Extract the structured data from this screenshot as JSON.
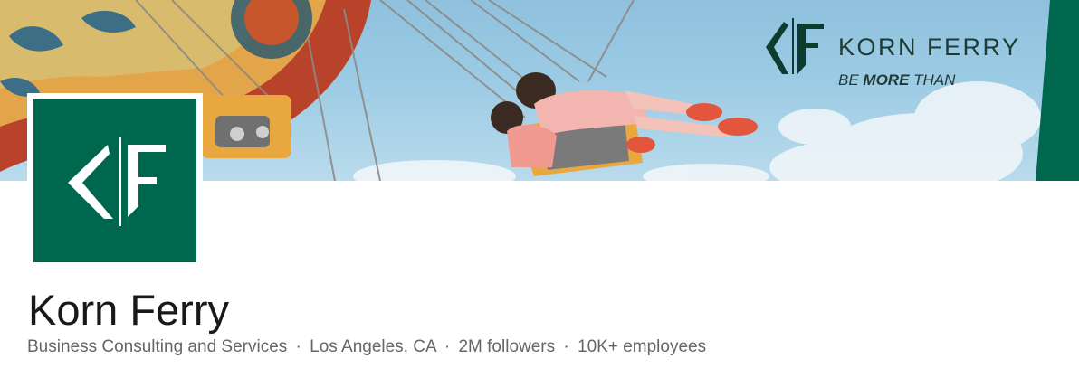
{
  "banner": {
    "brand_name": "KORN FERRY",
    "tagline_prefix": "BE ",
    "tagline_bold": "MORE",
    "tagline_suffix": " THAN"
  },
  "company": {
    "name": "Korn Ferry",
    "industry": "Business Consulting and Services",
    "location": "Los Angeles, CA",
    "followers": "2M followers",
    "employees": "10K+ employees",
    "separator": "·"
  },
  "colors": {
    "brand_green": "#00674f",
    "sky": "#9ccbe4",
    "text_primary": "#191919",
    "text_secondary": "#666666",
    "link_blue": "#0a66c2"
  }
}
